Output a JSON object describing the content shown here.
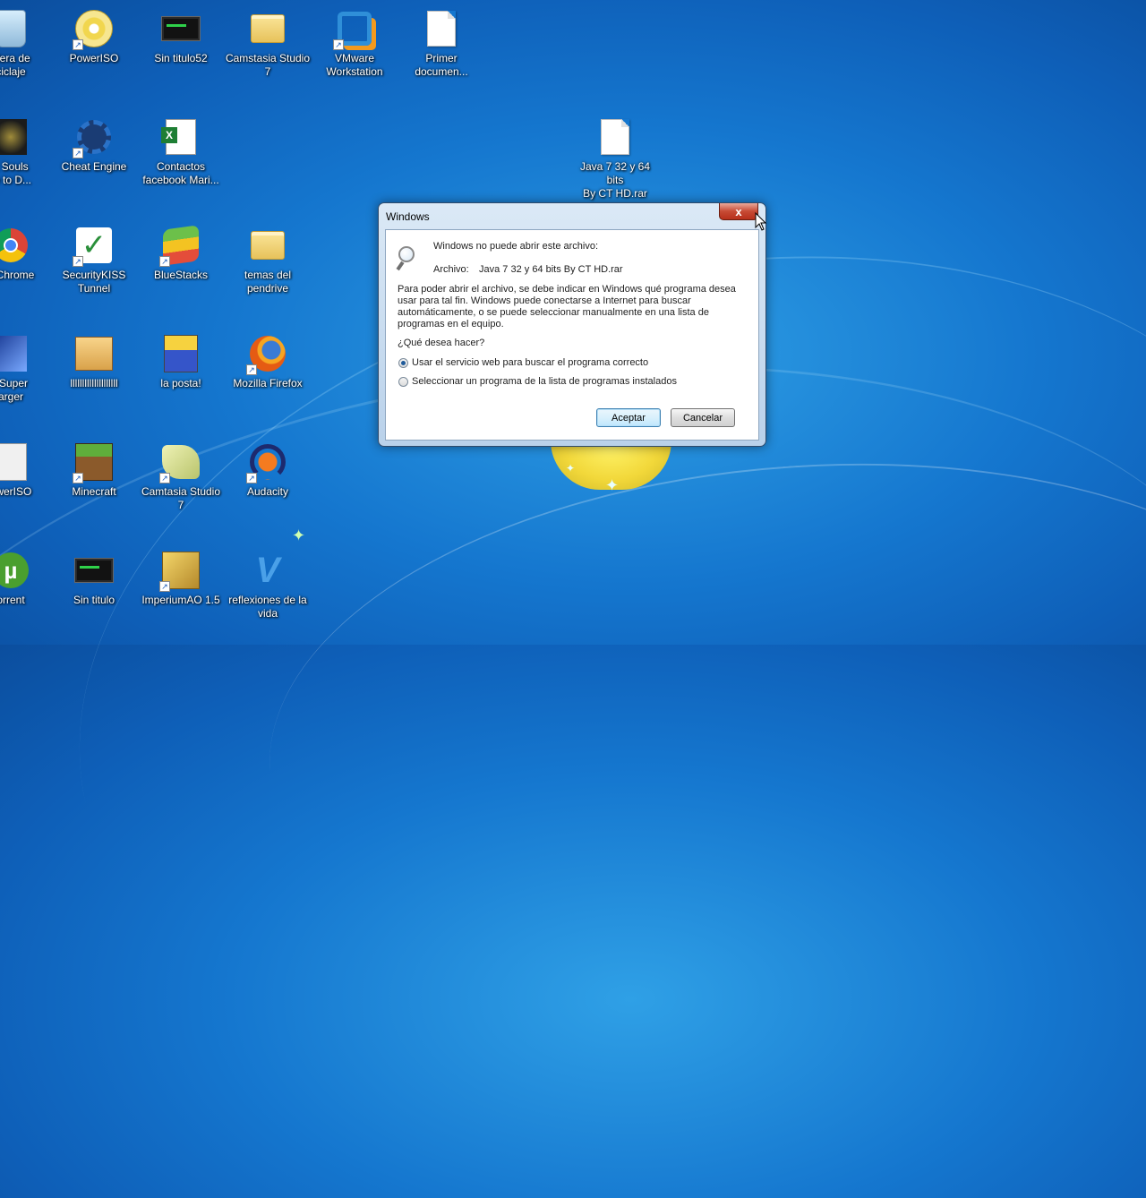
{
  "desktop": {
    "icons": [
      {
        "label": "elera de\nciclaje",
        "icon": "recycle-bin-icon"
      },
      {
        "label": "PowerISO",
        "icon": "disc-icon"
      },
      {
        "label": "Sin titulo52",
        "icon": "video-icon"
      },
      {
        "label": "Camstasia Studio\n7",
        "icon": "folder-icon"
      },
      {
        "label": "VMware\nWorkstation",
        "icon": "vmware-icon"
      },
      {
        "label": "Primer\ndocumen...",
        "icon": "document-icon"
      },
      {
        "label": "k Souls\nre to D...",
        "icon": "game-icon"
      },
      {
        "label": "Cheat Engine",
        "icon": "gear-icon"
      },
      {
        "label": "Contactos\nfacebook Mari...",
        "icon": "excel-icon"
      },
      {
        "label": "Java 7 32 y 64 bits\nBy CT HD.rar",
        "icon": "document-icon"
      },
      {
        "label": "e Chrome",
        "icon": "chrome-icon"
      },
      {
        "label": "SecurityKISS\nTunnel",
        "icon": "check-icon"
      },
      {
        "label": "BlueStacks",
        "icon": "bluestacks-icon"
      },
      {
        "label": "temas del\npendrive",
        "icon": "folder-icon"
      },
      {
        "label": "l Super\narger",
        "icon": "blue-app-icon"
      },
      {
        "label": "llllllllllllllllllll",
        "icon": "game-icon"
      },
      {
        "label": "la posta!",
        "icon": "simpsons-icon"
      },
      {
        "label": "Mozilla Firefox",
        "icon": "firefox-icon"
      },
      {
        "label": "owerISO",
        "icon": "document-icon"
      },
      {
        "label": "Minecraft",
        "icon": "minecraft-icon"
      },
      {
        "label": "Camtasia Studio\n7",
        "icon": "camtasia-icon"
      },
      {
        "label": "Audacity",
        "icon": "audacity-icon"
      },
      {
        "label": "orrent",
        "icon": "utorrent-icon"
      },
      {
        "label": "Sin titulo",
        "icon": "video-icon"
      },
      {
        "label": "ImperiumAO 1.5",
        "icon": "imperium-icon"
      },
      {
        "label": "reflexiones de la\nvida",
        "icon": "v-icon"
      }
    ]
  },
  "dialog": {
    "title": "Windows",
    "close_label": "x",
    "heading": "Windows no puede abrir este archivo:",
    "file_label": "Archivo:",
    "file_name": "Java 7 32 y 64 bits By CT HD.rar",
    "description": "Para poder abrir el archivo, se debe indicar en Windows qué programa desea usar para tal fin. Windows  puede conectarse a Internet para buscar automáticamente, o se puede seleccionar manualmente en una lista de programas en el equipo.",
    "question": "¿Qué desea hacer?",
    "options": [
      {
        "label": "Usar el servicio web para buscar el programa correcto",
        "selected": true
      },
      {
        "label": "Seleccionar un programa de la lista de programas instalados",
        "selected": false
      }
    ],
    "ok_label": "Aceptar",
    "cancel_label": "Cancelar"
  }
}
